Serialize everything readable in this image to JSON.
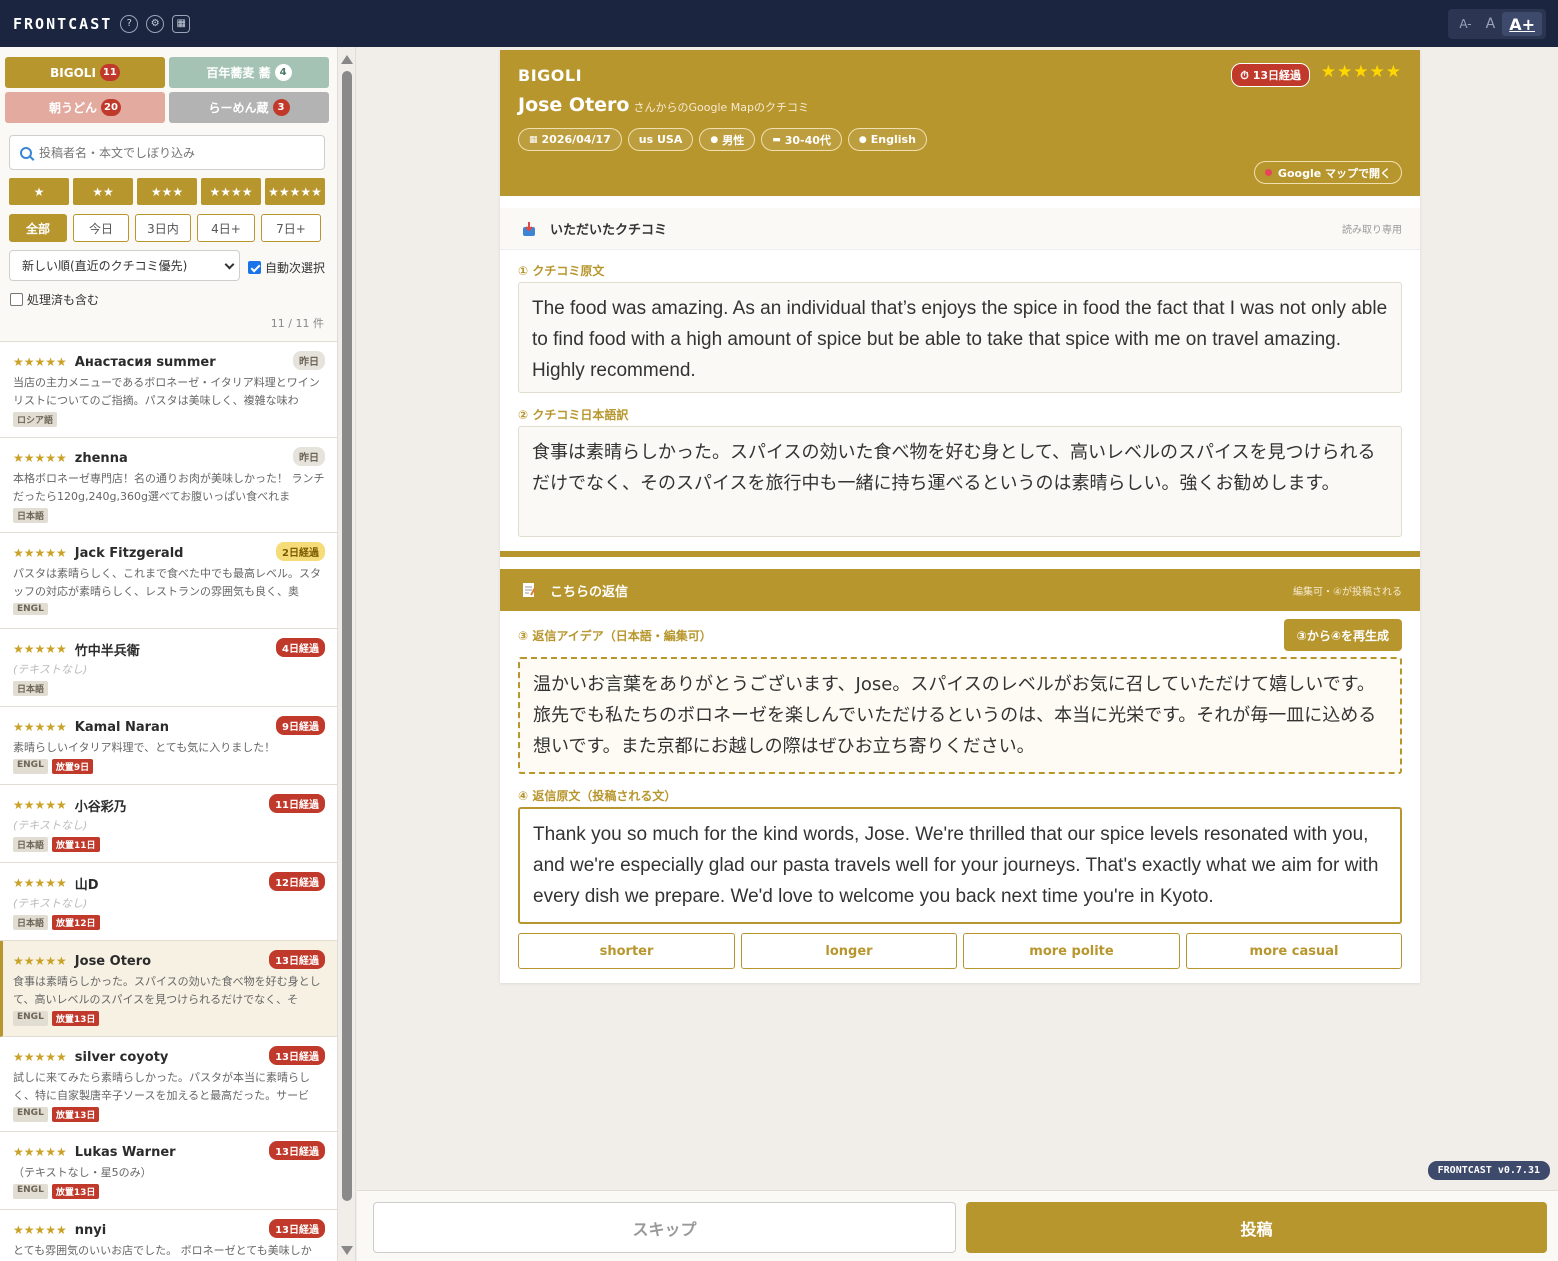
{
  "app": {
    "brand": "FRONTCAST",
    "help_icon": "?",
    "font_sizes": {
      "small": "A-",
      "normal": "A",
      "large": "A+"
    },
    "version": "FRONTCAST v0.7.31"
  },
  "sidebar": {
    "store_tabs": [
      {
        "label": "BIGOLI",
        "count": "11"
      },
      {
        "label": "百年蕎麦 蕎",
        "count": "4"
      },
      {
        "label": "朝うどん",
        "count": "20"
      },
      {
        "label": "らーめん蔵",
        "count": "3"
      }
    ],
    "search_placeholder": "投稿者名・本文でしぼり込み",
    "star_filters": [
      "★",
      "★★",
      "★★★",
      "★★★★",
      "★★★★★"
    ],
    "day_filters": [
      "全部",
      "今日",
      "3日内",
      "4日+",
      "7日+"
    ],
    "sort_value": "新しい順(直近のクチコミ優先)",
    "auto_next_label": "自動次選択",
    "include_done_label": "処理済も含む",
    "count_label": "11 / 11 件",
    "reviews": [
      {
        "stars": "★★★★★",
        "name": "Анастасия summer",
        "badge": "昨日",
        "text": "当店の主力メニューであるボロネーゼ・イタリア料理とワインリストについてのご指摘。パスタは美味しく、複雑な味わ",
        "tags": [
          "ロシア語"
        ]
      },
      {
        "stars": "★★★★★",
        "name": "zhenna",
        "badge": "昨日",
        "text": "本格ボロネーゼ専門店！名の通りお肉が美味しかった！ ランチだったら120g,240g,360g選べてお腹いっぱい食べれま",
        "tags": [
          "日本語"
        ]
      },
      {
        "stars": "★★★★★",
        "name": "Jack Fitzgerald",
        "badge": "2日経過",
        "text": "パスタは素晴らしく、これまで食べた中でも最高レベル。スタッフの対応が素晴らしく、レストランの雰囲気も良く、奥",
        "tags": [
          "ENGL"
        ]
      },
      {
        "stars": "★★★★★",
        "name": "竹中半兵衛",
        "badge": "4日経過",
        "text": "(テキストなし)",
        "tags": [
          "日本語"
        ]
      },
      {
        "stars": "★★★★★",
        "name": "Kamal Naran",
        "badge": "9日経過",
        "text": "素晴らしいイタリア料理で、とても気に入りました！",
        "tags": [
          "ENGL",
          "放置9日"
        ]
      },
      {
        "stars": "★★★★★",
        "name": "小谷彩乃",
        "badge": "11日経過",
        "text": "(テキストなし)",
        "tags": [
          "日本語",
          "放置11日"
        ]
      },
      {
        "stars": "★★★★★",
        "name": "山D",
        "badge": "12日経過",
        "text": "(テキストなし)",
        "tags": [
          "日本語",
          "放置12日"
        ]
      },
      {
        "stars": "★★★★★",
        "name": "Jose Otero",
        "badge": "13日経過",
        "text": "食事は素晴らしかった。スパイスの効いた食べ物を好む身として、高いレベルのスパイスを見つけられるだけでなく、そ",
        "tags": [
          "ENGL",
          "放置13日"
        ]
      },
      {
        "stars": "★★★★★",
        "name": "silver coyoty",
        "badge": "13日経過",
        "text": "試しに来てみたら素晴らしかった。パスタが本当に素晴らしく、特に自家製唐辛子ソースを加えると最高だった。サービ",
        "tags": [
          "ENGL",
          "放置13日"
        ]
      },
      {
        "stars": "★★★★★",
        "name": "Lukas Warner",
        "badge": "13日経過",
        "text": "（テキストなし・星5のみ）",
        "tags": [
          "ENGL",
          "放置13日"
        ]
      },
      {
        "stars": "★★★★★",
        "name": "nnyi",
        "badge": "13日経過",
        "text": "とても雰囲気のいいお店でした。 ボロネーゼとても美味しか",
        "tags": []
      }
    ]
  },
  "detail": {
    "store": "BIGOLI",
    "reviewer": "Jose Otero",
    "reviewer_suffix": "さんからのGoogle Mapのクチコミ",
    "elapsed": "13日経過",
    "stars": "★★★★★",
    "chips": {
      "date": "2026/04/17",
      "country": "us USA",
      "gender": "男性",
      "age": "30-40代",
      "language": "English"
    },
    "gmap_button": "Google マップで開く",
    "received_section": {
      "title": "いただいたクチコミ",
      "note": "読み取り専用"
    },
    "original_label": "① クチコミ原文",
    "original_text": "The food was amazing. As an individual that’s enjoys the spice in food the fact that I was not only able to find food with a high amount of spice but be able to take that spice with me on travel amazing. Highly recommend.",
    "jp_label": "② クチコミ日本語訳",
    "jp_text": "食事は素晴らしかった。スパイスの効いた食べ物を好む身として、高いレベルのスパイスを見つけられるだけでなく、そのスパイスを旅行中も一緒に持ち運べるというのは素晴らしい。強くお勧めします。",
    "reply_section": {
      "title": "こちらの返信",
      "note": "編集可・④が投稿される"
    },
    "idea_label": "③ 返信アイデア（日本語・編集可）",
    "regen_button": "③から④を再生成",
    "idea_text": "温かいお言葉をありがとうございます、Jose。スパイスのレベルがお気に召していただけて嬉しいです。旅先でも私たちのボロネーゼを楽しんでいただけるというのは、本当に光栄です。それが毎一皿に込める想いです。また京都にお越しの際はぜひお立ち寄りください。",
    "final_label": "④ 返信原文（投稿される文）",
    "final_text": "Thank you so much for the kind words, Jose. We're thrilled that our spice levels resonated with you, and we're especially glad our pasta travels well for your journeys. That's exactly what we aim for with every dish we prepare. We'd love to welcome you back next time you're in Kyoto.",
    "tone_buttons": [
      "shorter",
      "longer",
      "more polite",
      "more casual"
    ]
  },
  "actions": {
    "skip": "スキップ",
    "post": "投稿"
  },
  "colors": {
    "accent": "#b8962e",
    "topbar": "#1b2540",
    "alert": "#c0392b"
  }
}
